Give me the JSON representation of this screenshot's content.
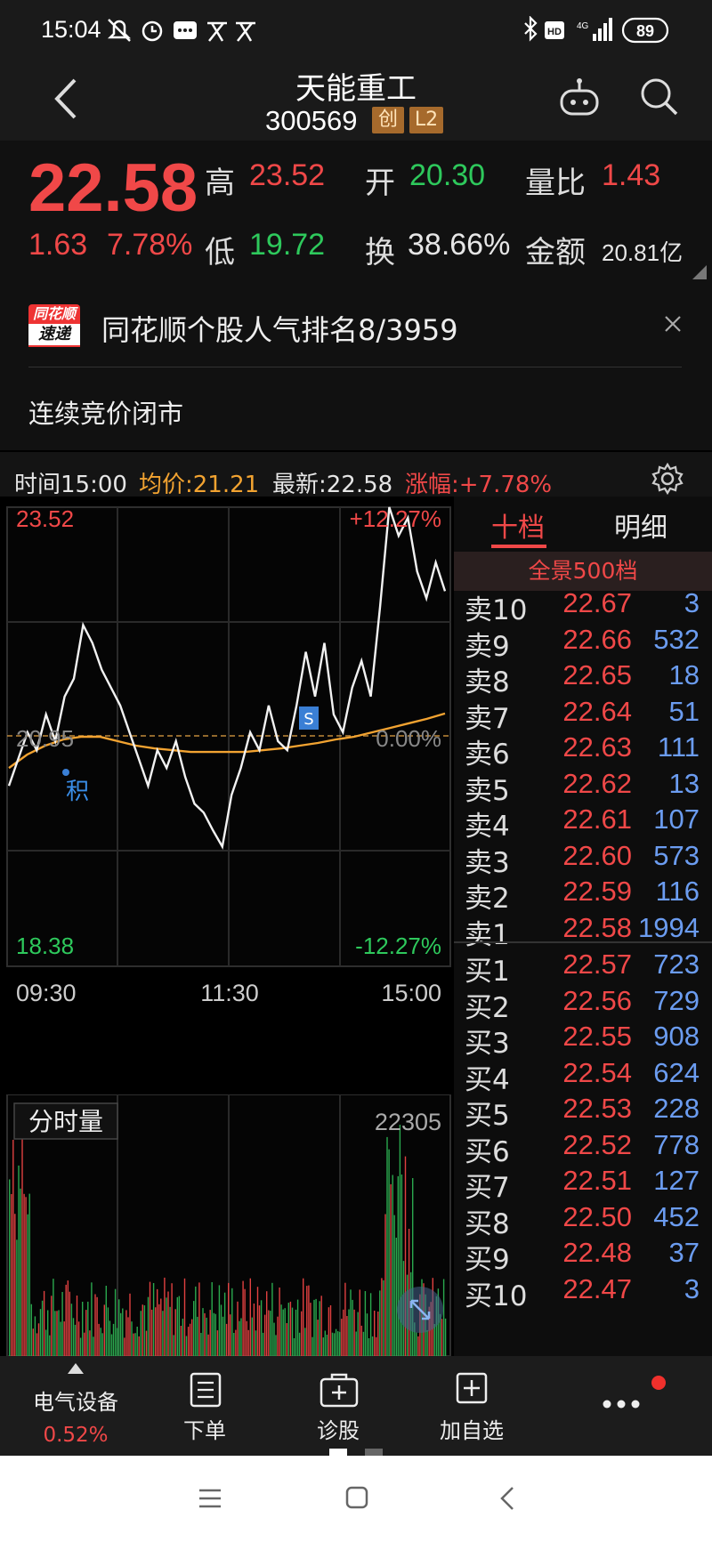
{
  "status_bar": {
    "time": "15:04",
    "battery": "89",
    "network": "4G",
    "hd": "HD"
  },
  "header": {
    "name": "天能重工",
    "code": "300569",
    "tag_chuang": "创",
    "tag_l2": "L2"
  },
  "quote": {
    "price": "22.58",
    "change": "1.63",
    "change_pct": "7.78%",
    "high_label": "高",
    "high": "23.52",
    "low_label": "低",
    "low": "19.72",
    "open_label": "开",
    "open": "20.30",
    "turnover_label": "换",
    "turnover": "38.66%",
    "volume_ratio_label": "量比",
    "volume_ratio": "1.43",
    "amount_label": "金额",
    "amount": "20.81亿"
  },
  "news": {
    "logo_top": "同花顺",
    "logo_bottom": "速递",
    "headline": "同花顺个股人气排名8/3959",
    "subline": "连续竞价闭市"
  },
  "info_row": {
    "time": "时间15:00",
    "avg": "均价:21.21",
    "latest": "最新:22.58",
    "pct": "涨幅:+7.78%"
  },
  "chart": {
    "y_top": "23.52",
    "y_mid": "20.95",
    "y_bottom": "18.38",
    "pct_top": "+12.27%",
    "pct_mid": "0.00%",
    "pct_bottom": "-12.27%",
    "x_labels": [
      "09:30",
      "11:30",
      "15:00"
    ],
    "marker_s": "S",
    "marker_ji": "积"
  },
  "chart_data": {
    "type": "line",
    "series": [
      {
        "name": "price",
        "values": [
          20.4,
          20.7,
          21.0,
          20.8,
          21.2,
          20.9,
          21.4,
          21.6,
          22.2,
          22.0,
          21.7,
          21.5,
          21.3,
          21.0,
          20.7,
          20.4,
          20.8,
          20.6,
          20.9,
          20.5,
          20.2,
          20.1,
          19.9,
          19.72,
          20.3,
          20.6,
          21.0,
          20.8,
          21.3,
          20.9,
          20.8,
          21.3,
          21.9,
          21.4,
          22.0,
          21.2,
          21.0,
          21.5,
          21.8,
          21.4,
          22.4,
          23.52,
          23.2,
          23.4,
          22.8,
          22.5,
          22.9,
          22.58
        ]
      },
      {
        "name": "avg",
        "values": [
          20.6,
          20.75,
          20.85,
          20.92,
          20.95,
          20.95,
          20.9,
          20.85,
          20.82,
          20.8,
          20.78,
          20.78,
          20.78,
          20.78,
          20.8,
          20.82,
          20.85,
          20.88,
          20.92,
          20.95,
          21.0,
          21.05,
          21.1,
          21.15,
          21.21
        ]
      }
    ],
    "ylim": [
      18.38,
      23.52
    ]
  },
  "volume": {
    "label": "分时量",
    "max": "22305"
  },
  "book": {
    "tab_active": "十档",
    "tab_other": "明细",
    "full_depth": "全景500档",
    "asks": [
      {
        "label": "卖10",
        "price": "22.67",
        "vol": "3"
      },
      {
        "label": "卖9",
        "price": "22.66",
        "vol": "532"
      },
      {
        "label": "卖8",
        "price": "22.65",
        "vol": "18"
      },
      {
        "label": "卖7",
        "price": "22.64",
        "vol": "51"
      },
      {
        "label": "卖6",
        "price": "22.63",
        "vol": "111"
      },
      {
        "label": "卖5",
        "price": "22.62",
        "vol": "13"
      },
      {
        "label": "卖4",
        "price": "22.61",
        "vol": "107"
      },
      {
        "label": "卖3",
        "price": "22.60",
        "vol": "573"
      },
      {
        "label": "卖2",
        "price": "22.59",
        "vol": "116"
      },
      {
        "label": "卖1",
        "price": "22.58",
        "vol": "1994"
      }
    ],
    "bids": [
      {
        "label": "买1",
        "price": "22.57",
        "vol": "723"
      },
      {
        "label": "买2",
        "price": "22.56",
        "vol": "729"
      },
      {
        "label": "买3",
        "price": "22.55",
        "vol": "908"
      },
      {
        "label": "买4",
        "price": "22.54",
        "vol": "624"
      },
      {
        "label": "买5",
        "price": "22.53",
        "vol": "228"
      },
      {
        "label": "买6",
        "price": "22.52",
        "vol": "778"
      },
      {
        "label": "买7",
        "price": "22.51",
        "vol": "127"
      },
      {
        "label": "买8",
        "price": "22.50",
        "vol": "452"
      },
      {
        "label": "买9",
        "price": "22.48",
        "vol": "37"
      },
      {
        "label": "买10",
        "price": "22.47",
        "vol": "3"
      }
    ]
  },
  "toolbar": {
    "sector": "电气设备",
    "sector_pct": "0.52%",
    "order": "下单",
    "diagnose": "诊股",
    "add_watch": "加自选"
  },
  "colors": {
    "up": "#f04848",
    "down": "#2ec95c",
    "avg_line": "#f2a331",
    "vol_blue": "#6b9cf0"
  }
}
